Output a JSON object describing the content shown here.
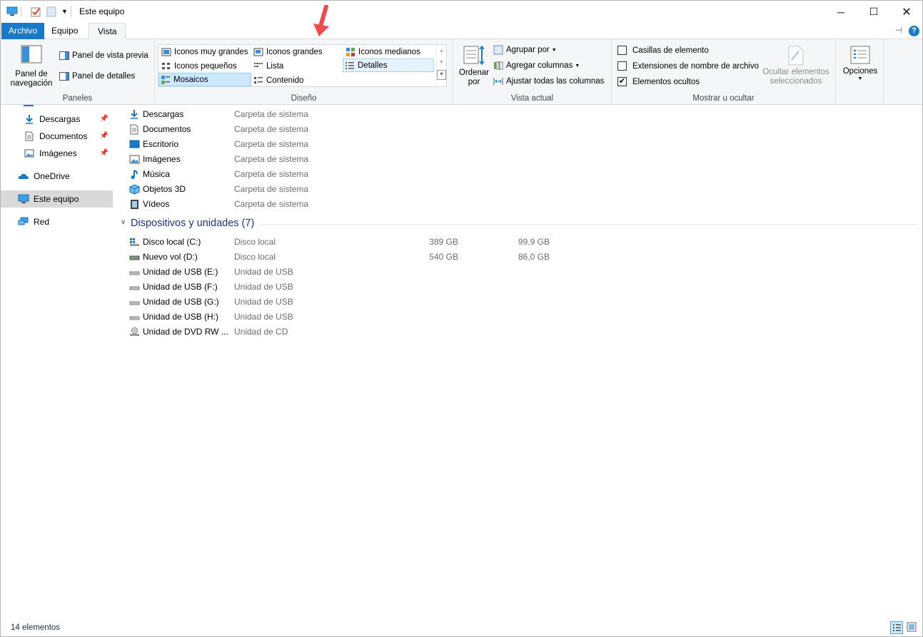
{
  "window": {
    "title": "Este equipo"
  },
  "tabs": [
    "Archivo",
    "Equipo",
    "Vista"
  ],
  "ribbon": {
    "panes": {
      "nav_label": "Panel de navegación",
      "preview_label": "Panel de vista previa",
      "details_label": "Panel de detalles",
      "group_label": "Paneles"
    },
    "layout": {
      "items": [
        "Iconos muy grandes",
        "Iconos grandes",
        "Iconos medianos",
        "Iconos pequeños",
        "Lista",
        "Detalles",
        "Mosaicos",
        "Contenido"
      ],
      "selected": "Mosaicos",
      "group_label": "Diseño"
    },
    "current_view": {
      "sort_label": "Ordenar por",
      "group_by": "Agrupar por",
      "add_columns": "Agregar columnas",
      "fit_columns": "Ajustar todas las columnas",
      "group_label": "Vista actual"
    },
    "show_hide": {
      "item_checkboxes": "Casillas de elemento",
      "file_extensions": "Extensiones de nombre de archivo",
      "hidden_items": "Elementos ocultos",
      "hide_selected": "Ocultar elementos seleccionados",
      "group_label": "Mostrar u ocultar",
      "checked": {
        "item_checkboxes": false,
        "file_extensions": false,
        "hidden_items": true
      }
    },
    "options_label": "Opciones"
  },
  "nav": {
    "items": [
      {
        "label": "Descargas",
        "pinned": true
      },
      {
        "label": "Documentos",
        "pinned": true
      },
      {
        "label": "Imágenes",
        "pinned": true
      },
      {
        "label": "OneDrive"
      },
      {
        "label": "Este equipo",
        "selected": true
      },
      {
        "label": "Red"
      }
    ]
  },
  "folders": [
    {
      "name": "Descargas",
      "type": "Carpeta de sistema"
    },
    {
      "name": "Documentos",
      "type": "Carpeta de sistema"
    },
    {
      "name": "Escritorio",
      "type": "Carpeta de sistema"
    },
    {
      "name": "Imágenes",
      "type": "Carpeta de sistema"
    },
    {
      "name": "Música",
      "type": "Carpeta de sistema"
    },
    {
      "name": "Objetos 3D",
      "type": "Carpeta de sistema"
    },
    {
      "name": "Vídeos",
      "type": "Carpeta de sistema"
    }
  ],
  "devices_section": "Dispositivos y unidades (7)",
  "devices": [
    {
      "name": "Disco local (C:)",
      "type": "Disco local",
      "total": "389 GB",
      "free": "99,9 GB"
    },
    {
      "name": "Nuevo vol (D:)",
      "type": "Disco local",
      "total": "540 GB",
      "free": "86,0 GB"
    },
    {
      "name": "Unidad de USB (E:)",
      "type": "Unidad de USB"
    },
    {
      "name": "Unidad de USB (F:)",
      "type": "Unidad de USB"
    },
    {
      "name": "Unidad de USB (G:)",
      "type": "Unidad de USB"
    },
    {
      "name": "Unidad de USB (H:)",
      "type": "Unidad de USB"
    },
    {
      "name": "Unidad de DVD RW ...",
      "type": "Unidad de CD"
    }
  ],
  "status": "14 elementos",
  "colors": {
    "accent": "#1979ca",
    "section_title": "#1e3287",
    "selection": "#cce8ff",
    "arrow": "#ef4b4b"
  }
}
